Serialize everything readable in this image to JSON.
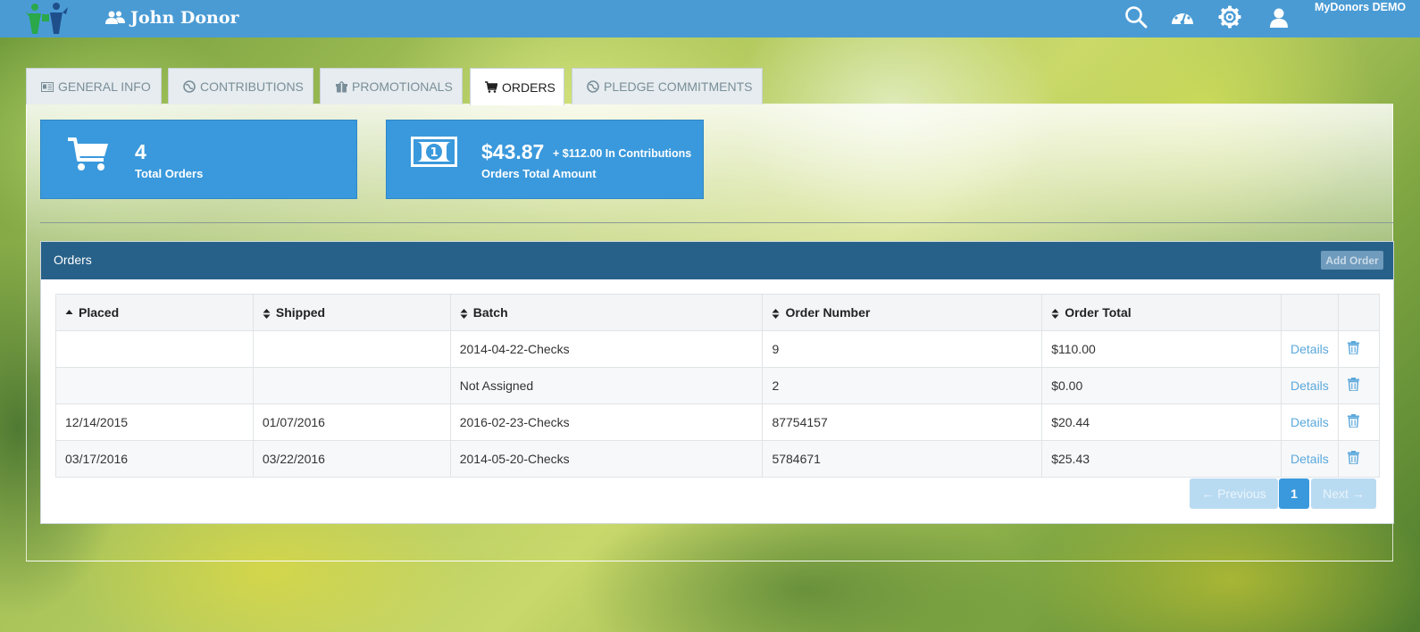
{
  "header": {
    "user_name": "John Donor",
    "account_label": "MyDonors DEMO",
    "icons": [
      "search-icon",
      "dashboard-icon",
      "gear-icon",
      "user-icon"
    ]
  },
  "tabs": [
    {
      "label": "GENERAL INFO",
      "icon": "id-card-icon"
    },
    {
      "label": "CONTRIBUTIONS",
      "icon": "globe-icon"
    },
    {
      "label": "PROMOTIONALS",
      "icon": "gift-icon"
    },
    {
      "label": "ORDERS",
      "icon": "cart-icon",
      "active": true
    },
    {
      "label": "PLEDGE COMMITMENTS",
      "icon": "globe-icon"
    }
  ],
  "stats": {
    "orders": {
      "value": "4",
      "label": "Total Orders",
      "icon": "cart-icon"
    },
    "amount": {
      "value": "$43.87",
      "extra": "+ $112.00 In Contributions",
      "label": "Orders Total Amount",
      "icon": "money-icon"
    }
  },
  "orders": {
    "title": "Orders",
    "add_label": "Add Order",
    "columns": [
      "Placed",
      "Shipped",
      "Batch",
      "Order Number",
      "Order Total"
    ],
    "rows": [
      {
        "placed": "",
        "shipped": "",
        "batch": "2014-04-22-Checks",
        "number": "9",
        "total": "$110.00",
        "action": "Details"
      },
      {
        "placed": "",
        "shipped": "",
        "batch": "Not Assigned",
        "number": "2",
        "total": "$0.00",
        "action": "Details"
      },
      {
        "placed": "12/14/2015",
        "shipped": "01/07/2016",
        "batch": "2016-02-23-Checks",
        "number": "87754157",
        "total": "$20.44",
        "action": "Details"
      },
      {
        "placed": "03/17/2016",
        "shipped": "03/22/2016",
        "batch": "2014-05-20-Checks",
        "number": "5784671",
        "total": "$25.43",
        "action": "Details"
      }
    ],
    "pager": {
      "prev": "← Previous",
      "page": "1",
      "next": "Next →"
    }
  },
  "colors": {
    "header": "#4a9bd4",
    "stat_box": "#3a99dc",
    "card_header": "#276189",
    "link": "#5ba8dc"
  }
}
